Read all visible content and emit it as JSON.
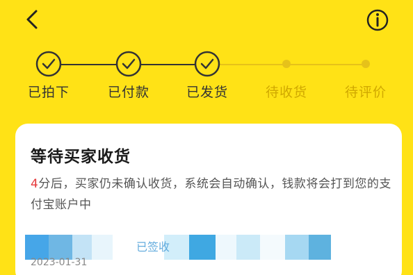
{
  "steps": [
    {
      "label": "已拍下",
      "status": "done"
    },
    {
      "label": "已付款",
      "status": "done"
    },
    {
      "label": "已发货",
      "status": "done"
    },
    {
      "label": "待收货",
      "status": "todo"
    },
    {
      "label": "待评价",
      "status": "todo"
    }
  ],
  "card": {
    "title": "等待买家收货",
    "countdown": "4",
    "desc_rest": "分后，买家仍未确认收货，系统会自动确认，钱款将会打到您的支付宝账户中"
  },
  "logistics": {
    "status": "已签收",
    "date": "2023-01-31"
  },
  "colors": {
    "background": "#FFE216",
    "done": "#333333",
    "todo": "#D0A800",
    "highlight": "#E5383B",
    "link": "#4A9ED8"
  },
  "icons": {
    "back": "back-arrow-icon",
    "info": "info-circle-icon",
    "check": "check-circle-icon"
  }
}
